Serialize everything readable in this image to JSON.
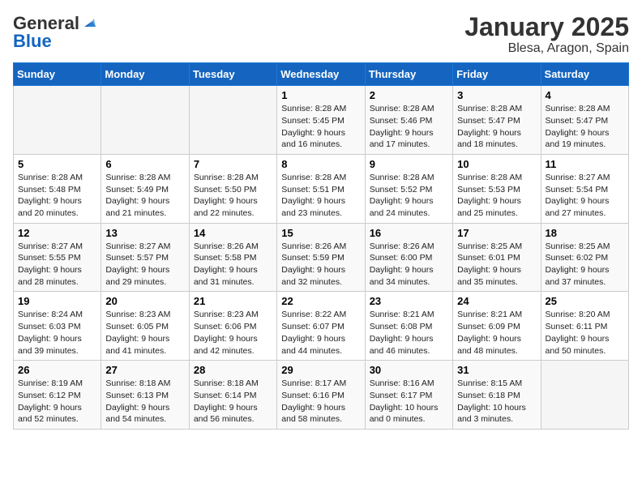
{
  "header": {
    "logo_line1": "General",
    "logo_line2": "Blue",
    "title": "January 2025",
    "subtitle": "Blesa, Aragon, Spain"
  },
  "days_of_week": [
    "Sunday",
    "Monday",
    "Tuesday",
    "Wednesday",
    "Thursday",
    "Friday",
    "Saturday"
  ],
  "weeks": [
    [
      {
        "day": "",
        "info": ""
      },
      {
        "day": "",
        "info": ""
      },
      {
        "day": "",
        "info": ""
      },
      {
        "day": "1",
        "info": "Sunrise: 8:28 AM\nSunset: 5:45 PM\nDaylight: 9 hours and 16 minutes."
      },
      {
        "day": "2",
        "info": "Sunrise: 8:28 AM\nSunset: 5:46 PM\nDaylight: 9 hours and 17 minutes."
      },
      {
        "day": "3",
        "info": "Sunrise: 8:28 AM\nSunset: 5:47 PM\nDaylight: 9 hours and 18 minutes."
      },
      {
        "day": "4",
        "info": "Sunrise: 8:28 AM\nSunset: 5:47 PM\nDaylight: 9 hours and 19 minutes."
      }
    ],
    [
      {
        "day": "5",
        "info": "Sunrise: 8:28 AM\nSunset: 5:48 PM\nDaylight: 9 hours and 20 minutes."
      },
      {
        "day": "6",
        "info": "Sunrise: 8:28 AM\nSunset: 5:49 PM\nDaylight: 9 hours and 21 minutes."
      },
      {
        "day": "7",
        "info": "Sunrise: 8:28 AM\nSunset: 5:50 PM\nDaylight: 9 hours and 22 minutes."
      },
      {
        "day": "8",
        "info": "Sunrise: 8:28 AM\nSunset: 5:51 PM\nDaylight: 9 hours and 23 minutes."
      },
      {
        "day": "9",
        "info": "Sunrise: 8:28 AM\nSunset: 5:52 PM\nDaylight: 9 hours and 24 minutes."
      },
      {
        "day": "10",
        "info": "Sunrise: 8:28 AM\nSunset: 5:53 PM\nDaylight: 9 hours and 25 minutes."
      },
      {
        "day": "11",
        "info": "Sunrise: 8:27 AM\nSunset: 5:54 PM\nDaylight: 9 hours and 27 minutes."
      }
    ],
    [
      {
        "day": "12",
        "info": "Sunrise: 8:27 AM\nSunset: 5:55 PM\nDaylight: 9 hours and 28 minutes."
      },
      {
        "day": "13",
        "info": "Sunrise: 8:27 AM\nSunset: 5:57 PM\nDaylight: 9 hours and 29 minutes."
      },
      {
        "day": "14",
        "info": "Sunrise: 8:26 AM\nSunset: 5:58 PM\nDaylight: 9 hours and 31 minutes."
      },
      {
        "day": "15",
        "info": "Sunrise: 8:26 AM\nSunset: 5:59 PM\nDaylight: 9 hours and 32 minutes."
      },
      {
        "day": "16",
        "info": "Sunrise: 8:26 AM\nSunset: 6:00 PM\nDaylight: 9 hours and 34 minutes."
      },
      {
        "day": "17",
        "info": "Sunrise: 8:25 AM\nSunset: 6:01 PM\nDaylight: 9 hours and 35 minutes."
      },
      {
        "day": "18",
        "info": "Sunrise: 8:25 AM\nSunset: 6:02 PM\nDaylight: 9 hours and 37 minutes."
      }
    ],
    [
      {
        "day": "19",
        "info": "Sunrise: 8:24 AM\nSunset: 6:03 PM\nDaylight: 9 hours and 39 minutes."
      },
      {
        "day": "20",
        "info": "Sunrise: 8:23 AM\nSunset: 6:05 PM\nDaylight: 9 hours and 41 minutes."
      },
      {
        "day": "21",
        "info": "Sunrise: 8:23 AM\nSunset: 6:06 PM\nDaylight: 9 hours and 42 minutes."
      },
      {
        "day": "22",
        "info": "Sunrise: 8:22 AM\nSunset: 6:07 PM\nDaylight: 9 hours and 44 minutes."
      },
      {
        "day": "23",
        "info": "Sunrise: 8:21 AM\nSunset: 6:08 PM\nDaylight: 9 hours and 46 minutes."
      },
      {
        "day": "24",
        "info": "Sunrise: 8:21 AM\nSunset: 6:09 PM\nDaylight: 9 hours and 48 minutes."
      },
      {
        "day": "25",
        "info": "Sunrise: 8:20 AM\nSunset: 6:11 PM\nDaylight: 9 hours and 50 minutes."
      }
    ],
    [
      {
        "day": "26",
        "info": "Sunrise: 8:19 AM\nSunset: 6:12 PM\nDaylight: 9 hours and 52 minutes."
      },
      {
        "day": "27",
        "info": "Sunrise: 8:18 AM\nSunset: 6:13 PM\nDaylight: 9 hours and 54 minutes."
      },
      {
        "day": "28",
        "info": "Sunrise: 8:18 AM\nSunset: 6:14 PM\nDaylight: 9 hours and 56 minutes."
      },
      {
        "day": "29",
        "info": "Sunrise: 8:17 AM\nSunset: 6:16 PM\nDaylight: 9 hours and 58 minutes."
      },
      {
        "day": "30",
        "info": "Sunrise: 8:16 AM\nSunset: 6:17 PM\nDaylight: 10 hours and 0 minutes."
      },
      {
        "day": "31",
        "info": "Sunrise: 8:15 AM\nSunset: 6:18 PM\nDaylight: 10 hours and 3 minutes."
      },
      {
        "day": "",
        "info": ""
      }
    ]
  ]
}
